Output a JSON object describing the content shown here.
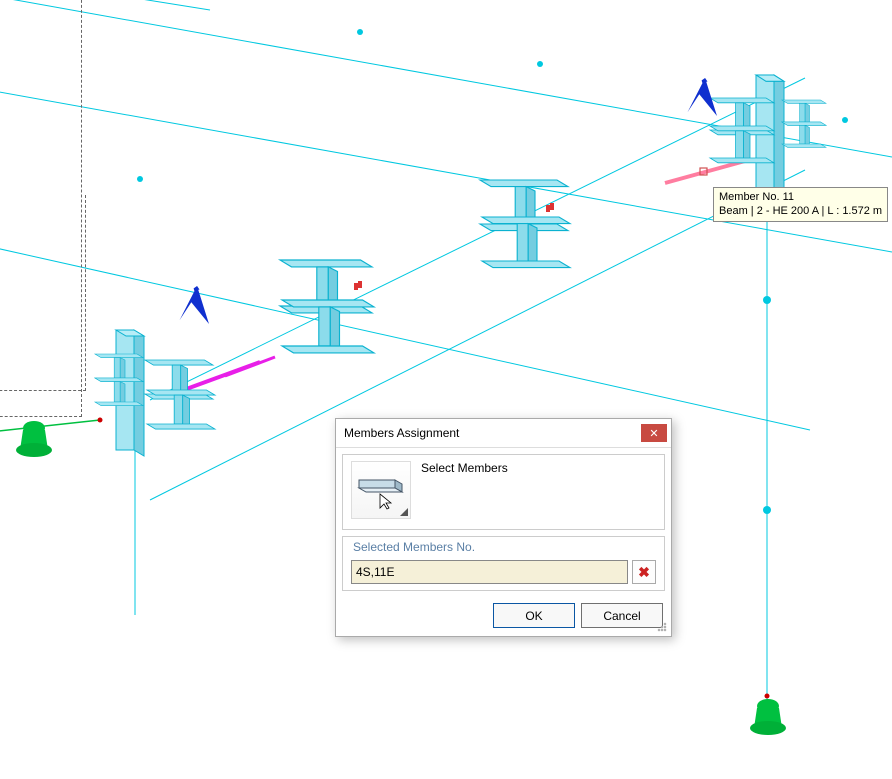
{
  "dialog": {
    "title": "Members Assignment",
    "select_members_label": "Select Members",
    "selected_members_label": "Selected Members No.",
    "selected_members_value": "4S,11E",
    "ok_label": "OK",
    "cancel_label": "Cancel"
  },
  "tooltip": {
    "line1": "Member No. 11",
    "line2": "Beam | 2 - HE 200 A | L : 1.572 m"
  },
  "colors": {
    "wire": "#00c8e0",
    "highlight_magenta": "#e81fe8",
    "highlight_pink": "#ff7da0",
    "beam_fill": "#a6e6f2",
    "beam_stroke": "#0bb2d0",
    "support": "#00c040",
    "arrow": "#1030cf"
  }
}
